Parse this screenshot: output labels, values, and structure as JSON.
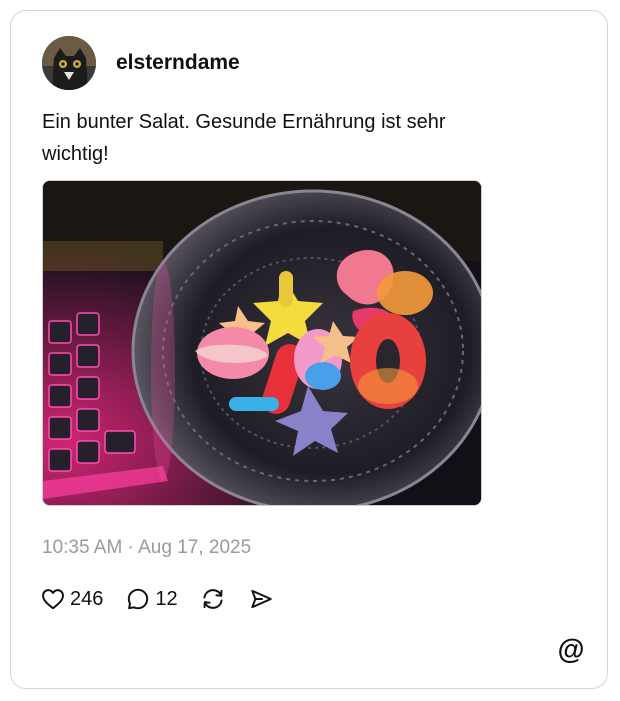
{
  "post": {
    "username": "elsterndame",
    "text": "Ein bunter Salat. Gesunde Ernährung ist sehr wichtig!",
    "timestamp": "10:35 AM · Aug 17, 2025"
  },
  "actions": {
    "likes": "246",
    "replies": "12"
  },
  "icons": {
    "like": "heart-icon",
    "reply": "comment-bubble-icon",
    "repost": "repost-icon",
    "share": "send-icon",
    "brand": "threads-logo-icon"
  },
  "colors": {
    "text": "#101010",
    "muted": "#9a9a9a",
    "border": "#d6d6d6"
  }
}
